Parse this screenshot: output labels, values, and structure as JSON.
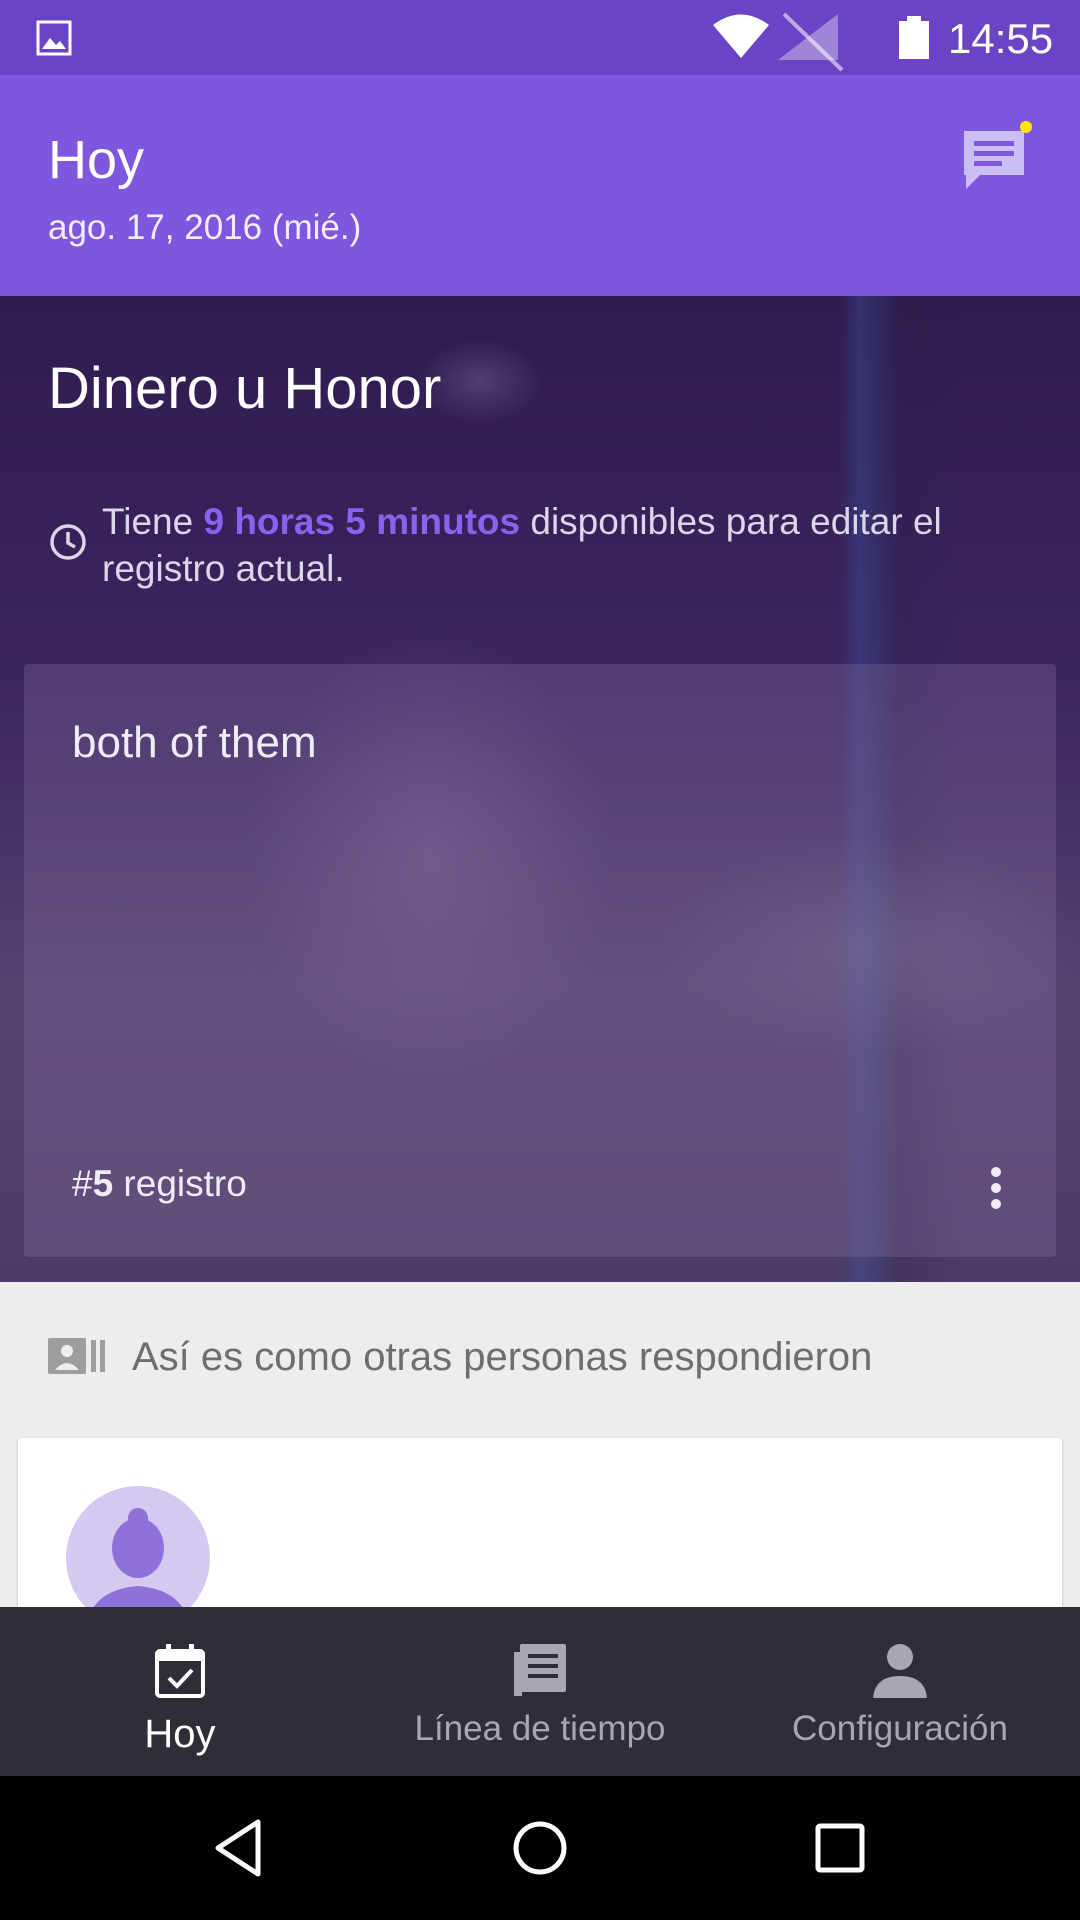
{
  "status_bar": {
    "time": "14:55",
    "icons": [
      "gallery-icon",
      "wifi-icon",
      "no-signal-icon",
      "battery-icon"
    ]
  },
  "app_bar": {
    "title": "Hoy",
    "date": "ago. 17, 2016 (mié.)",
    "action_icon": "chat-icon"
  },
  "hero": {
    "title": "Dinero u Honor",
    "notice_prefix": "Tiene ",
    "notice_highlight": "9 horas 5 minutos",
    "notice_suffix": " disponibles para editar el registro actual.",
    "entry": {
      "text": "both of them",
      "count_prefix": "#",
      "count_number": "5",
      "count_suffix": " registro"
    }
  },
  "others": {
    "label": "Así es como otras personas respondieron",
    "icon": "contact-card-icon"
  },
  "bottom_nav": {
    "items": [
      {
        "label": "Hoy",
        "icon": "calendar-check-icon",
        "active": true
      },
      {
        "label": "Línea de tiempo",
        "icon": "timeline-icon",
        "active": false
      },
      {
        "label": "Configuración",
        "icon": "person-icon",
        "active": false
      }
    ]
  },
  "colors": {
    "status_bar": "#6a44c4",
    "app_bar": "#7e57de",
    "highlight": "#8a62f0",
    "bottom_nav": "#302d36",
    "notification_dot": "#ffe600"
  }
}
